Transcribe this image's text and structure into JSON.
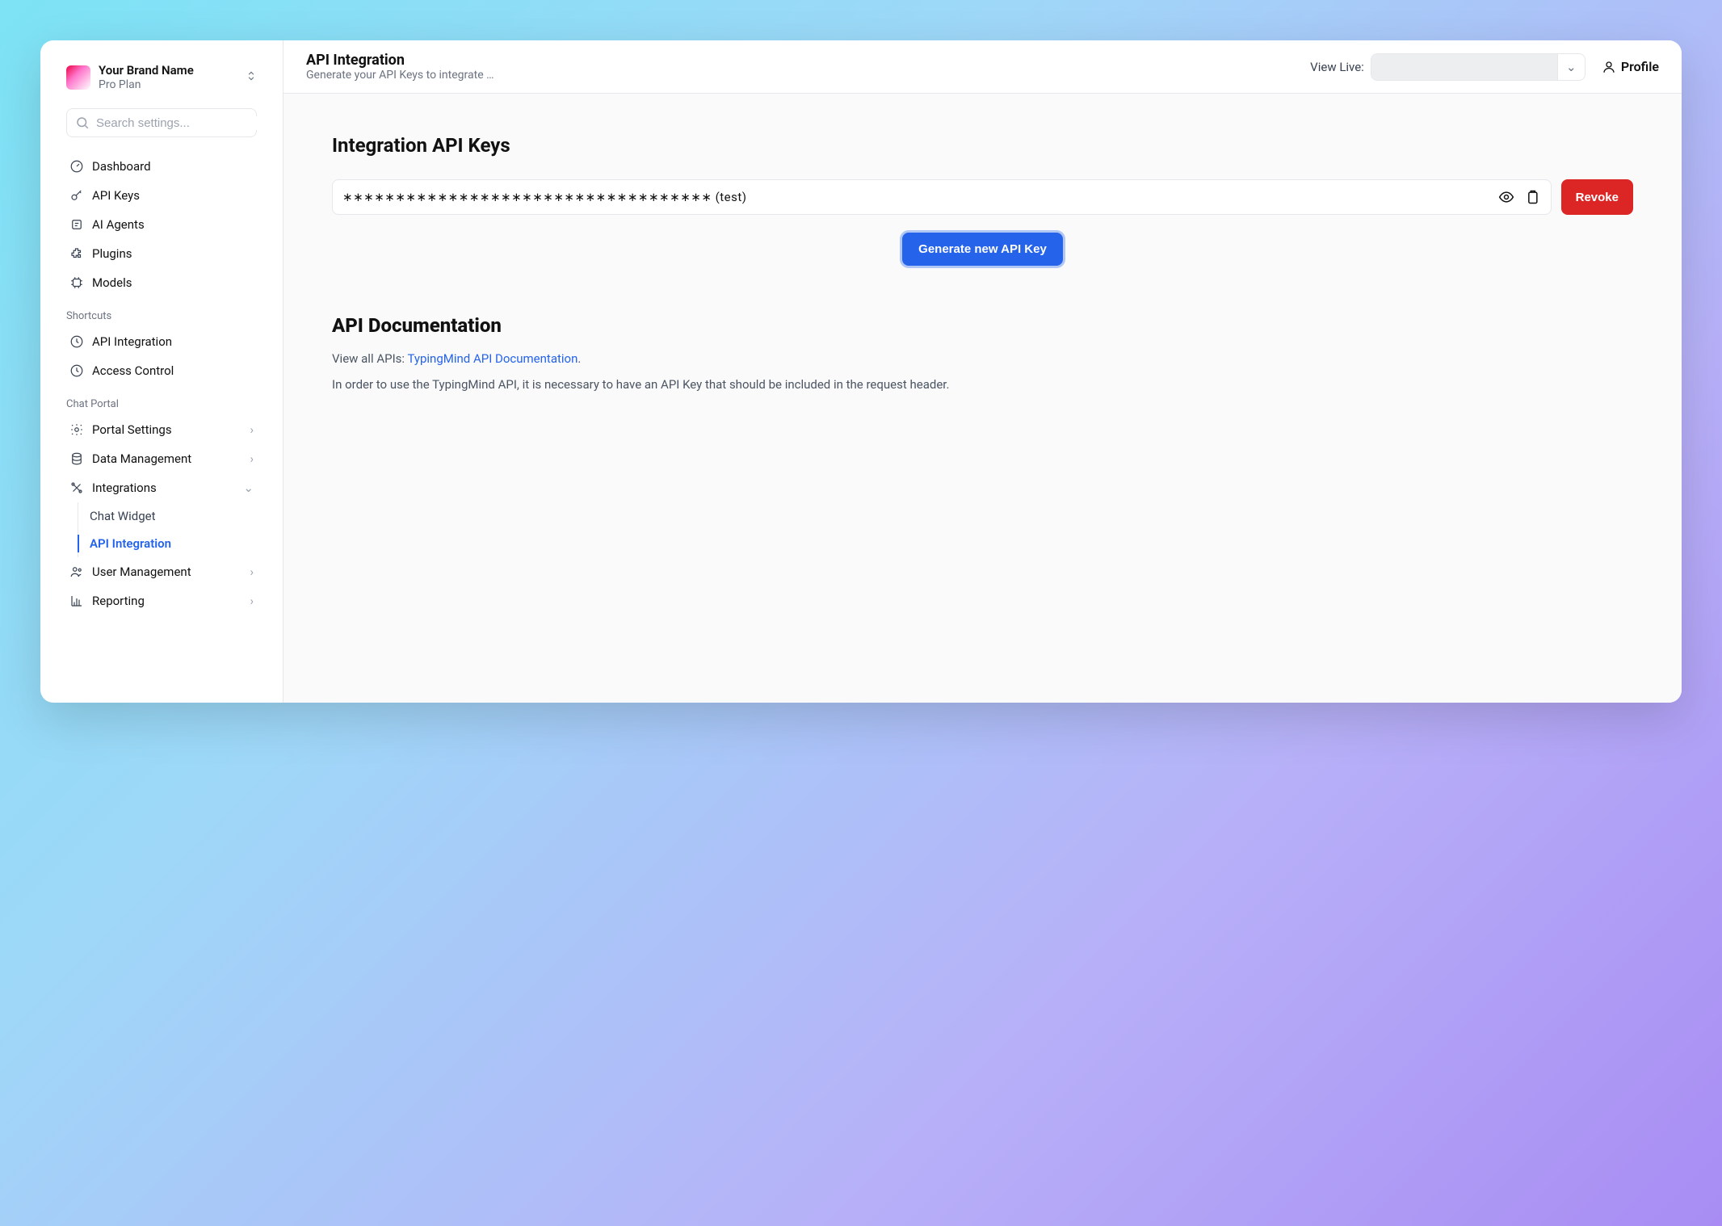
{
  "brand": {
    "name": "Your Brand Name",
    "plan": "Pro Plan"
  },
  "search": {
    "placeholder": "Search settings..."
  },
  "nav": {
    "main": [
      {
        "key": "dashboard",
        "label": "Dashboard"
      },
      {
        "key": "api-keys",
        "label": "API Keys"
      },
      {
        "key": "ai-agents",
        "label": "AI Agents"
      },
      {
        "key": "plugins",
        "label": "Plugins"
      },
      {
        "key": "models",
        "label": "Models"
      }
    ],
    "shortcuts_label": "Shortcuts",
    "shortcuts": [
      {
        "key": "api-integration",
        "label": "API Integration"
      },
      {
        "key": "access-control",
        "label": "Access Control"
      }
    ],
    "chat_portal_label": "Chat Portal",
    "chat_portal": [
      {
        "key": "portal-settings",
        "label": "Portal Settings",
        "hasCaret": true
      },
      {
        "key": "data-management",
        "label": "Data Management",
        "hasCaret": true
      },
      {
        "key": "integrations",
        "label": "Integrations",
        "expanded": true,
        "children": [
          {
            "key": "chat-widget",
            "label": "Chat Widget",
            "active": false
          },
          {
            "key": "api-integration-sub",
            "label": "API Integration",
            "active": true
          }
        ]
      },
      {
        "key": "user-management",
        "label": "User Management",
        "hasCaret": true
      },
      {
        "key": "reporting",
        "label": "Reporting",
        "hasCaret": true
      }
    ]
  },
  "header": {
    "title": "API Integration",
    "subtitle": "Generate your API Keys to integrate …",
    "view_live_label": "View Live:",
    "profile_label": "Profile"
  },
  "content": {
    "section1_title": "Integration API Keys",
    "api_key_display": "∗∗∗∗∗∗∗∗∗∗∗∗∗∗∗∗∗∗∗∗∗∗∗∗∗∗∗∗∗∗∗∗∗∗∗ (test)",
    "revoke_label": "Revoke",
    "generate_label": "Generate new API Key",
    "section2_title": "API Documentation",
    "doc_intro_prefix": "View all APIs: ",
    "doc_link_text": "TypingMind API Documentation",
    "doc_intro_suffix": ".",
    "doc_body": "In order to use the TypingMind API, it is necessary to have an API Key that should be included in the request header."
  }
}
